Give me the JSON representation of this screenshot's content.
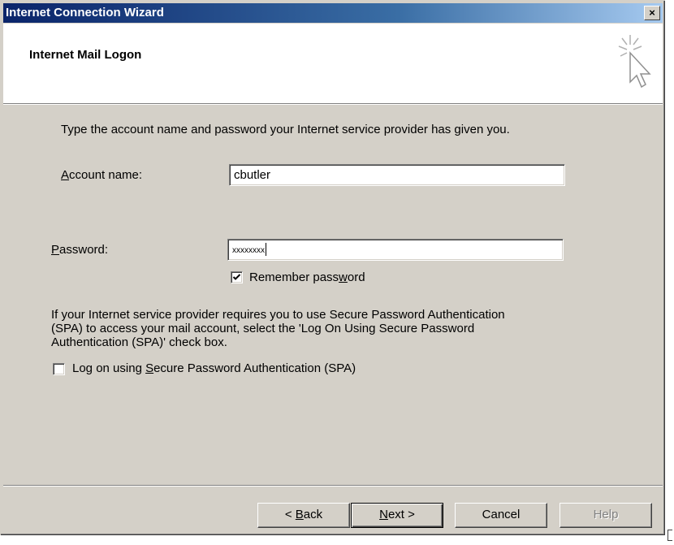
{
  "window": {
    "title": "Internet Connection Wizard",
    "close_label": "×"
  },
  "header": {
    "title": "Internet Mail Logon",
    "icon": "wizard-pointer-icon"
  },
  "body": {
    "intro": "Type the account name and password your Internet service provider has given you.",
    "account_label_prefix": "",
    "account_label_mnemonic": "A",
    "account_label_rest": "ccount name:",
    "account_value": "cbutler",
    "password_label_mnemonic": "P",
    "password_label_rest": "assword:",
    "password_value": "xxxxxxxx",
    "remember_prefix": "Remember pass",
    "remember_mnemonic": "w",
    "remember_rest": "ord",
    "remember_checked": true,
    "spa_paragraph_line1": "If your Internet service provider requires you to use Secure Password Authentication",
    "spa_paragraph_line2": "(SPA) to access your mail account, select the 'Log On Using Secure Password",
    "spa_paragraph_line3": "Authentication (SPA)' check box.",
    "spa_prefix": "Log on using ",
    "spa_mnemonic": "S",
    "spa_rest": "ecure Password Authentication (SPA)",
    "spa_checked": false
  },
  "buttons": {
    "back_prefix": "< ",
    "back_mnemonic": "B",
    "back_rest": "ack",
    "next_mnemonic": "N",
    "next_rest": "ext >",
    "cancel": "Cancel",
    "help": "Help"
  }
}
